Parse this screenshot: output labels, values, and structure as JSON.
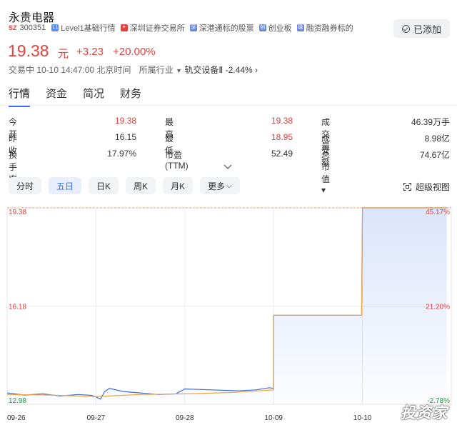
{
  "stock": {
    "name": "永贵电器",
    "market": "SZ",
    "code": "300351",
    "tags": [
      {
        "label": "Level1基础行情",
        "icon": "level1-icon",
        "color": "#5b8def"
      },
      {
        "label": "深圳证券交易所",
        "icon": "shenzhen-exchange-icon",
        "color": "#e5403c"
      },
      {
        "label": "深港通标的股票",
        "icon": "shenzhen-hk-connect-icon",
        "color": "#6c8be0"
      },
      {
        "label": "创业板",
        "icon": "chinext-icon",
        "color": "#6c8be0"
      },
      {
        "label": "融资融券标的",
        "icon": "margin-trading-icon",
        "color": "#6c8be0"
      }
    ],
    "added_label": "已添加",
    "price": "19.38",
    "unit": "元",
    "change": "+3.23",
    "change_pct": "+20.00%",
    "status": "交易中 10-10 14:47:00 北京时间",
    "industry_label": "所属行业",
    "industry_name": "轨交设备Ⅱ",
    "industry_change": "-2.44%"
  },
  "tabs": [
    "行情",
    "资金",
    "简况",
    "财务"
  ],
  "stats": [
    [
      {
        "label": "今开",
        "value": "19.38",
        "color": "red"
      },
      {
        "label": "最高",
        "value": "19.38",
        "color": "red"
      },
      {
        "label": "成交量",
        "value": "46.39万手",
        "color": "dark"
      }
    ],
    [
      {
        "label": "昨收",
        "value": "16.15",
        "color": "dark"
      },
      {
        "label": "最低",
        "value": "18.95",
        "color": "red"
      },
      {
        "label": "成交额",
        "value": "8.98亿",
        "color": "dark"
      }
    ],
    [
      {
        "label": "换手率",
        "value": "17.97%",
        "color": "dark"
      },
      {
        "label": "市盈(TTM)",
        "value": "52.49",
        "color": "dark"
      },
      {
        "label": "总市值 ▾",
        "value": "74.67亿",
        "color": "dark"
      }
    ]
  ],
  "periods": [
    "分时",
    "五日",
    "日K",
    "周K",
    "月K",
    "更多"
  ],
  "super_view": "超级视图",
  "watermark": "投资家",
  "chart_data": {
    "type": "line",
    "title": "五日",
    "x_ticks": [
      "09-26",
      "09-27",
      "09-28",
      "10-09",
      "10-10"
    ],
    "y_left_ticks": [
      "19.38",
      "16.18",
      "12.98"
    ],
    "y_right_ticks": [
      "45.17%",
      "21.20%",
      "-2.78%"
    ],
    "ylim": [
      12.98,
      19.38
    ],
    "prev_close_ref": 13.35,
    "series": [
      {
        "name": "",
        "color": "#3b6de8",
        "values": [
          [
            0,
            13.35
          ],
          [
            0.2,
            13.28
          ],
          [
            0.4,
            13.32
          ],
          [
            0.6,
            13.25
          ],
          [
            0.8,
            13.3
          ],
          [
            0.95,
            13.27
          ],
          [
            1.0,
            13.22
          ],
          [
            1.05,
            13.15
          ],
          [
            1.1,
            13.4
          ],
          [
            1.15,
            13.5
          ],
          [
            1.3,
            13.4
          ],
          [
            1.5,
            13.35
          ],
          [
            1.7,
            13.3
          ],
          [
            1.9,
            13.32
          ],
          [
            2.0,
            13.48
          ],
          [
            2.3,
            13.45
          ],
          [
            2.6,
            13.42
          ],
          [
            2.8,
            13.45
          ],
          [
            2.95,
            13.52
          ],
          [
            3.0,
            13.5
          ],
          [
            3.0,
            15.88
          ],
          [
            3.99,
            15.88
          ],
          [
            4.0,
            19.38
          ],
          [
            4.95,
            19.38
          ]
        ]
      },
      {
        "name": "",
        "color": "#f0a53c",
        "values": [
          [
            0,
            13.3
          ],
          [
            0.5,
            13.28
          ],
          [
            1.0,
            13.23
          ],
          [
            1.2,
            13.26
          ],
          [
            1.5,
            13.3
          ],
          [
            2.0,
            13.32
          ],
          [
            2.5,
            13.36
          ],
          [
            3.0,
            13.45
          ],
          [
            3.0,
            15.88
          ],
          [
            3.99,
            15.88
          ],
          [
            4.0,
            19.38
          ],
          [
            4.95,
            19.38
          ]
        ]
      }
    ]
  }
}
